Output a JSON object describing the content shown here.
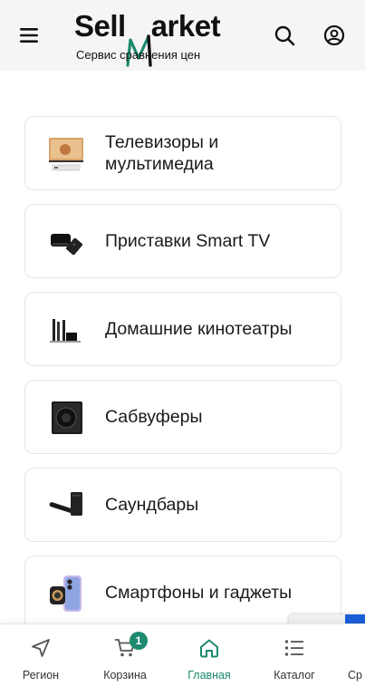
{
  "header": {
    "logo_text_a": "Sell",
    "logo_text_b": "arket",
    "logo_tagline": "Сервис сравнения цен",
    "accent_color": "#1d8a6e",
    "icons": [
      "menu-icon",
      "search-icon",
      "account-icon"
    ]
  },
  "categories": [
    {
      "label": "Телевизоры и мультимедиа",
      "icon": "tv-thumbnail"
    },
    {
      "label": "Приставки Smart TV",
      "icon": "tv-box-thumbnail"
    },
    {
      "label": "Домашние кинотеатры",
      "icon": "home-theater-thumbnail"
    },
    {
      "label": "Сабвуферы",
      "icon": "subwoofer-thumbnail"
    },
    {
      "label": "Саундбары",
      "icon": "soundbar-thumbnail"
    },
    {
      "label": "Смартфоны и гаджеты",
      "icon": "smartphone-thumbnail"
    }
  ],
  "tabbar": {
    "items": [
      {
        "label": "Регион",
        "icon": "navigation-arrow-icon"
      },
      {
        "label": "Корзина",
        "icon": "cart-icon",
        "badge": "1"
      },
      {
        "label": "Главная",
        "icon": "home-icon",
        "active": true
      },
      {
        "label": "Каталог",
        "icon": "catalog-list-icon"
      },
      {
        "label": "Ср",
        "icon": "compare-icon"
      }
    ]
  }
}
